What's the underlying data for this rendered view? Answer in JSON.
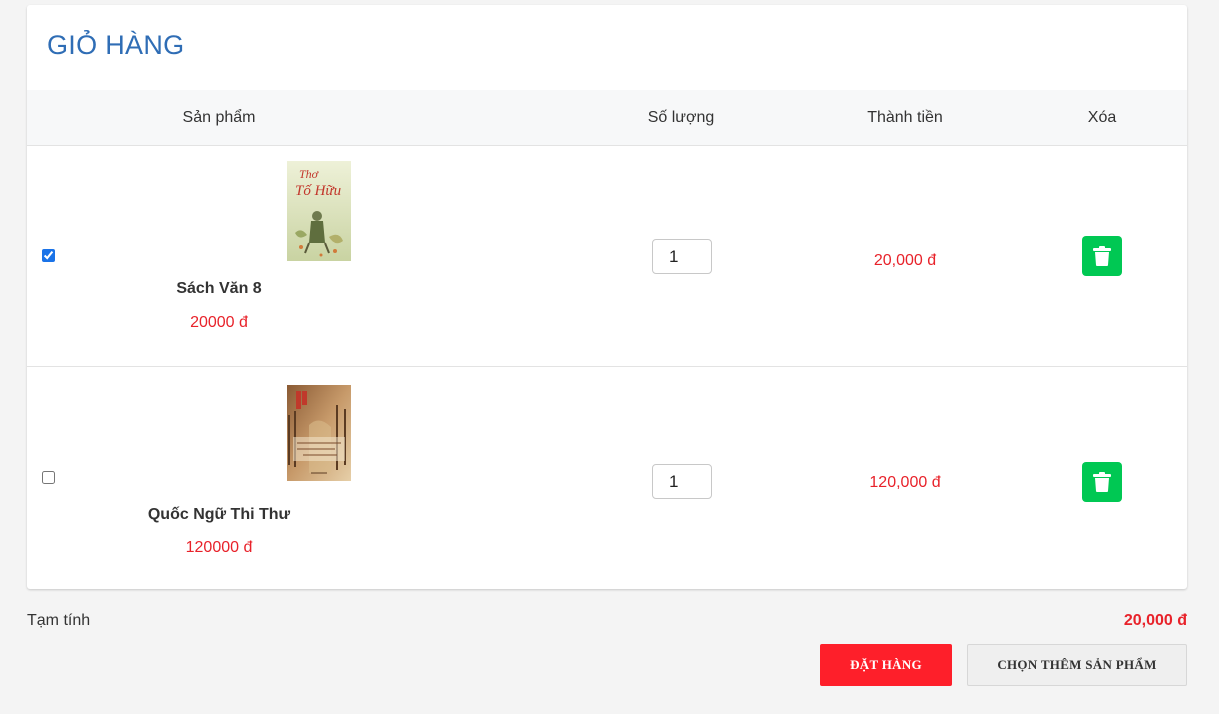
{
  "cart": {
    "title": "GIỎ HÀNG",
    "columns": {
      "product": "Sản phẩm",
      "quantity": "Số lượng",
      "total": "Thành tiền",
      "delete": "Xóa"
    },
    "items": [
      {
        "checked": true,
        "cover_text": "Thơ Tố Hữu",
        "name": "Sách Văn 8",
        "price": "20000 đ",
        "quantity": "1",
        "line_total": "20,000 đ"
      },
      {
        "checked": false,
        "name": "Quốc Ngữ Thi Thư",
        "price": "120000 đ",
        "quantity": "1",
        "line_total": "120,000 đ"
      }
    ]
  },
  "summary": {
    "subtotal_label": "Tạm tính",
    "subtotal_value": "20,000 đ"
  },
  "actions": {
    "order_label": "ĐẶT HÀNG",
    "continue_label": "CHỌN THÊM SẢN PHẨM"
  },
  "icons": {
    "delete": "trash-icon"
  },
  "colors": {
    "title": "#2f6db5",
    "price": "#e8222a",
    "delete_button": "#00c853",
    "order_button": "#fe1f2a"
  }
}
